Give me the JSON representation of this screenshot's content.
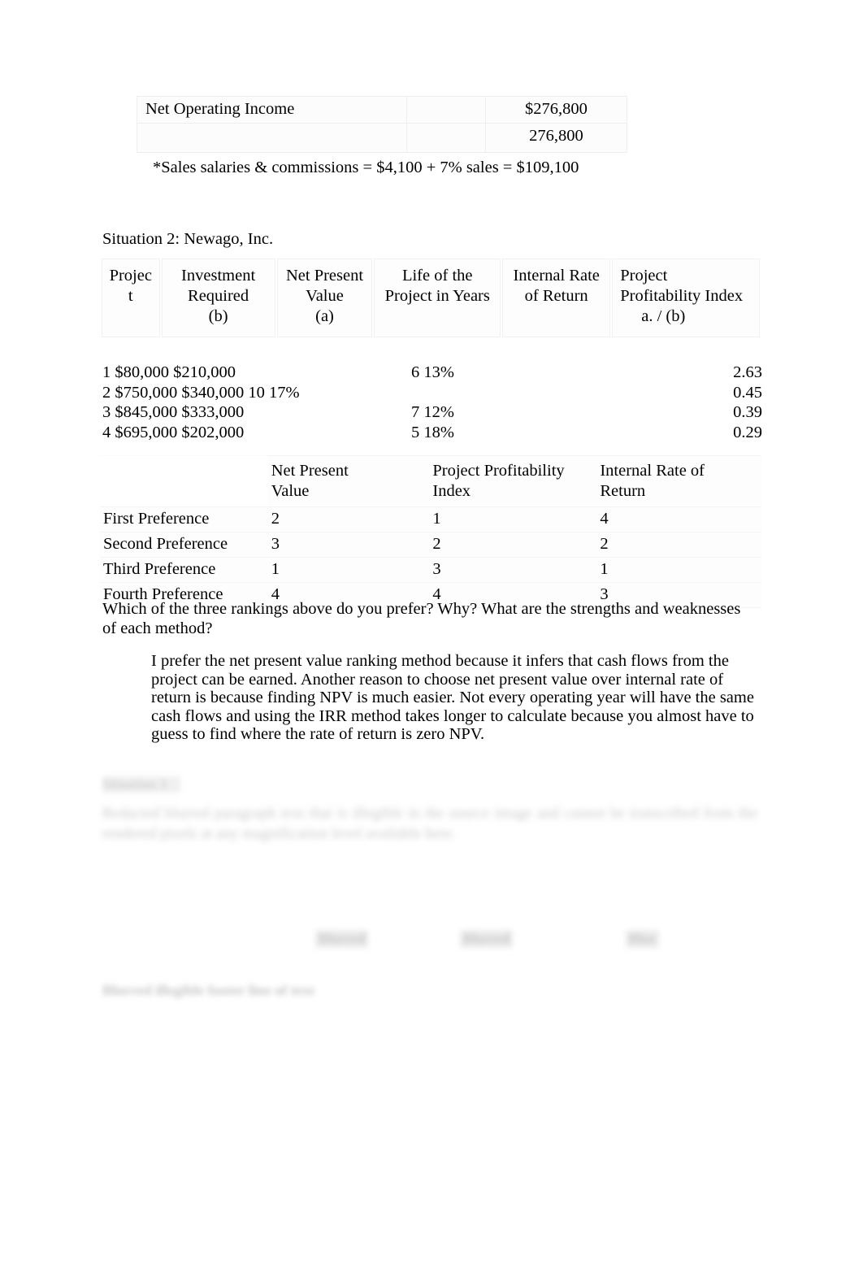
{
  "document": {
    "net_operating_income_table": {
      "rows": [
        {
          "label": "Net Operating Income",
          "spacer": "",
          "amount": "$276,800"
        },
        {
          "label": "",
          "spacer": "",
          "amount": "276,800"
        }
      ]
    },
    "sales_note": "*Sales salaries & commissions = $4,100 + 7% sales = $109,100",
    "situation2_heading": "Situation 2:  Newago, Inc.",
    "project_table": {
      "headers": [
        "Projec\nt",
        "Investment\nRequired\n(b)",
        "Net Present\nValue\n(a)",
        "Life of the\nProject in Years",
        "Internal Rate\nof Return",
        "Project\nProfitability Index\na.   / (b)"
      ],
      "header_parts": {
        "project": {
          "line1": "Projec",
          "line2": "t"
        },
        "investment_required": {
          "line1": "Investment",
          "line2": "Required",
          "line3": "(b)"
        },
        "net_present_value": {
          "line1": "Net Present",
          "line2": "Value",
          "line3": "(a)"
        },
        "life_of_project": {
          "line1": "Life of the",
          "line2": "Project in Years"
        },
        "internal_rate_of_return": {
          "line1": "Internal Rate",
          "line2": "of Return"
        },
        "project_profitability_index": {
          "line1": "Project",
          "line2": "Profitability Index",
          "line3": "a.   / (b)"
        }
      },
      "rows": [
        {
          "left": "1 $80,000 $210,000",
          "mid": "6 13%",
          "right": "2.63"
        },
        {
          "left": "2 $750,000 $340,000 10 17%",
          "mid": "",
          "right": "0.45"
        },
        {
          "left": "3 $845,000 $333,000",
          "mid": "7 12%",
          "right": "0.39"
        },
        {
          "left": "4 $695,000 $202,000",
          "mid": "5 18%",
          "right": "0.29"
        }
      ]
    },
    "preference_table": {
      "headers": [
        "",
        "Net Present Value",
        "Project Profitability Index",
        "Internal Rate of Return"
      ],
      "header_parts": [
        {
          "line1": "",
          "line2": ""
        },
        {
          "line1": "Net Present",
          "line2": "Value"
        },
        {
          "line1": "Project Profitability",
          "line2": "Index"
        },
        {
          "line1": "Internal Rate of",
          "line2": "Return"
        }
      ],
      "rows": [
        {
          "label": "First Preference",
          "npv": "2",
          "ppi": "1",
          "irr": "4"
        },
        {
          "label": "Second Preference",
          "npv": "3",
          "ppi": "2",
          "irr": "2"
        },
        {
          "label": "Third Preference",
          "npv": "1",
          "ppi": "3",
          "irr": "1"
        },
        {
          "label": "Fourth Preference",
          "npv": "4",
          "ppi": "4",
          "irr": "3"
        }
      ]
    },
    "question": "Which of the three rankings above do you prefer? Why? What are the strengths and weaknesses of each method?",
    "answer": "I prefer the net present value ranking method because it infers that cash flows from the project can be earned. Another reason to choose net present value over internal rate of return is because finding NPV is much easier. Not every operating year will have the same cash flows and using the IRR method takes longer to calculate because you almost have to guess to find where the rate of return is zero NPV.",
    "redacted": {
      "heading": "Situation 3",
      "paragraph": "Redacted blurred paragraph text that is illegible in the source image and cannot be transcribed from the rendered pixels at any magnification level available here.",
      "columns": [
        "Blurred",
        "Blurred",
        "Blur"
      ],
      "footer_line": "Blurred illegible footer line of text"
    }
  }
}
